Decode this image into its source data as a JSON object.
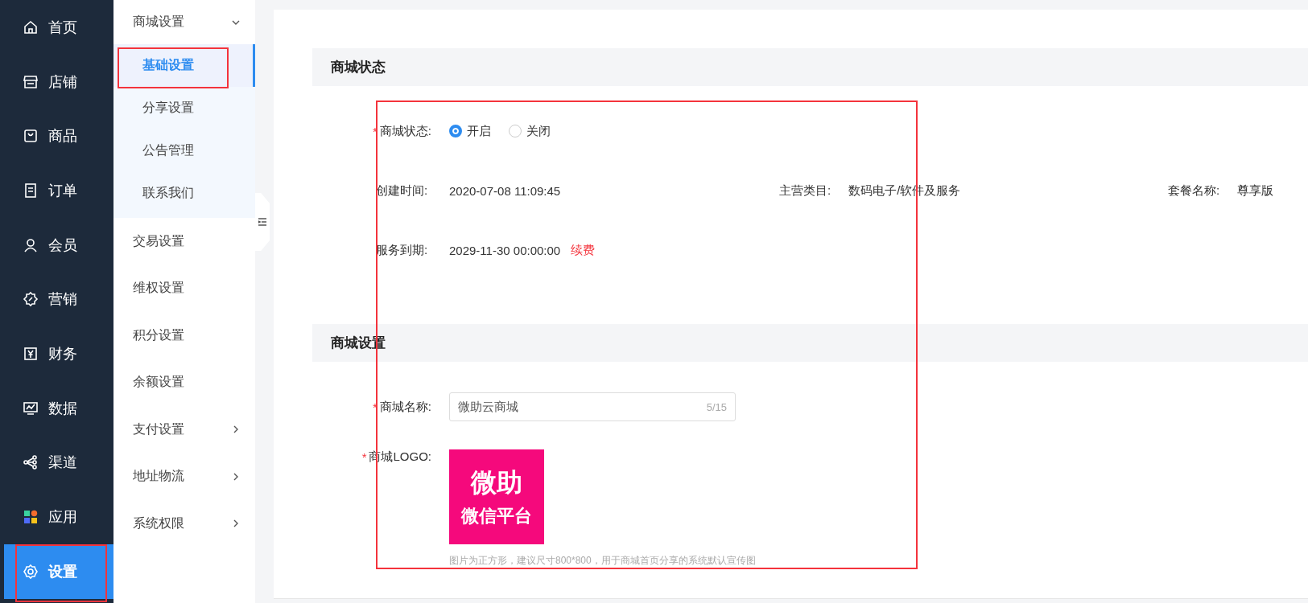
{
  "nav": [
    {
      "label": "首页",
      "selected": false,
      "highlighted": false
    },
    {
      "label": "店铺",
      "selected": false,
      "highlighted": false
    },
    {
      "label": "商品",
      "selected": false,
      "highlighted": false
    },
    {
      "label": "订单",
      "selected": false,
      "highlighted": false
    },
    {
      "label": "会员",
      "selected": false,
      "highlighted": false
    },
    {
      "label": "营销",
      "selected": false,
      "highlighted": false
    },
    {
      "label": "财务",
      "selected": false,
      "highlighted": false
    },
    {
      "label": "数据",
      "selected": false,
      "highlighted": false
    },
    {
      "label": "渠道",
      "selected": false,
      "highlighted": false
    },
    {
      "label": "应用",
      "selected": false,
      "highlighted": false
    },
    {
      "label": "设置",
      "selected": true,
      "highlighted": true
    }
  ],
  "submenu": [
    {
      "label": "商城设置",
      "kind": "group",
      "expanded": true,
      "children": [
        {
          "label": "基础设置",
          "selected": true,
          "highlighted": true
        },
        {
          "label": "分享设置",
          "selected": false,
          "highlighted": false
        },
        {
          "label": "公告管理",
          "selected": false,
          "highlighted": false
        },
        {
          "label": "联系我们",
          "selected": false,
          "highlighted": false
        }
      ]
    },
    {
      "label": "交易设置",
      "kind": "link"
    },
    {
      "label": "维权设置",
      "kind": "link"
    },
    {
      "label": "积分设置",
      "kind": "link"
    },
    {
      "label": "余额设置",
      "kind": "link"
    },
    {
      "label": "支付设置",
      "kind": "folder"
    },
    {
      "label": "地址物流",
      "kind": "folder"
    },
    {
      "label": "系统权限",
      "kind": "folder"
    }
  ],
  "form_highlighted": true,
  "status_section": {
    "title": "商城状态",
    "status": {
      "label": "商城状态:",
      "required_mark": "*",
      "options": [
        {
          "label": "开启",
          "selected": true
        },
        {
          "label": "关闭",
          "selected": false
        }
      ]
    },
    "info": [
      {
        "label": "创建时间:",
        "value": "2020-07-08 11:09:45"
      },
      {
        "label": "主营类目:",
        "value": "数码电子/软件及服务"
      },
      {
        "label": "套餐名称:",
        "value": "尊享版"
      }
    ],
    "expiry": {
      "label": "服务到期:",
      "value": "2029-11-30 00:00:00",
      "link": "续费"
    }
  },
  "settings_section": {
    "title": "商城设置",
    "name_field": {
      "label": "商城名称:",
      "required_mark": "*",
      "value": "微助云商城",
      "count": "5/15"
    },
    "logo": {
      "label": "商城LOGO:",
      "required_mark": "*",
      "line_1": "微助",
      "line_2": "微信平台",
      "hint": "图片为正方形，建议尺寸800*800，用于商城首页分享的系统默认宣传图"
    }
  }
}
